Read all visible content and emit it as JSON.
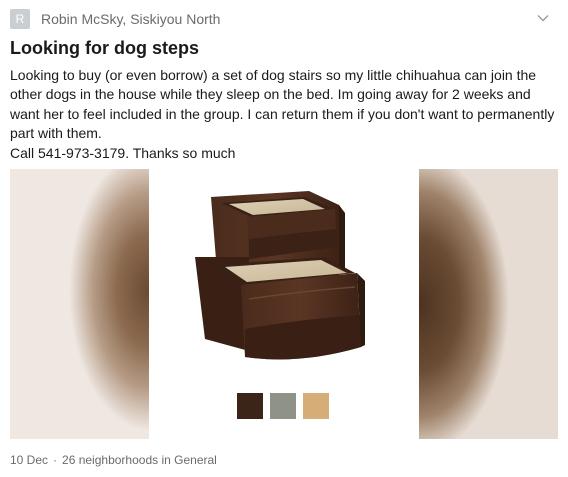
{
  "header": {
    "avatar_initial": "R",
    "author_line": "Robin McSky, Siskiyou North",
    "menu_icon": "chevron-down-icon"
  },
  "post": {
    "title": "Looking for dog steps",
    "paragraph1": "Looking to buy (or even borrow) a set of dog stairs so my little chihuahua can join the other dogs in the house while they sleep on the bed.  Im going away for 2 weeks and want her to feel included in the group.  I can return them if you don't want to permanently part with them.",
    "paragraph2": "Call  541-973-3179.  Thanks so much"
  },
  "gallery": {
    "color_swatches": [
      "#3b2418",
      "#8f9289",
      "#d6ad76"
    ]
  },
  "footer": {
    "date": "10 Dec",
    "separator": "·",
    "audience": "26 neighborhoods",
    "in_word": "in",
    "category": "General"
  }
}
